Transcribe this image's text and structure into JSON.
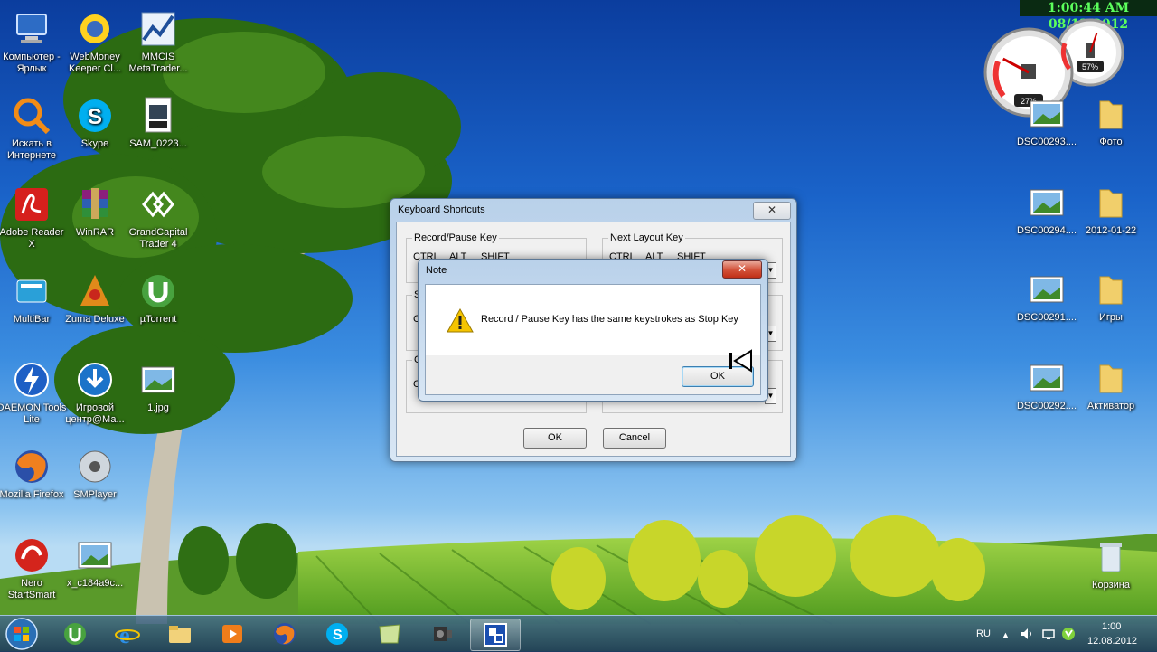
{
  "desktop": {
    "left_icons": [
      {
        "label": "Компьютер - Ярлык",
        "icon": "computer-icon"
      },
      {
        "label": "WebMoney Keeper Cl...",
        "icon": "webmoney-icon"
      },
      {
        "label": "MMCIS MetaTrader...",
        "icon": "metatrader-icon"
      },
      {
        "label": "Искать в Интернете",
        "icon": "search-globe-icon"
      },
      {
        "label": "Skype",
        "icon": "skype-icon"
      },
      {
        "label": "SAM_0223...",
        "icon": "video-file-icon"
      },
      {
        "label": "Adobe Reader X",
        "icon": "adobe-reader-icon"
      },
      {
        "label": "WinRAR",
        "icon": "winrar-icon"
      },
      {
        "label": "GrandCapital Trader 4",
        "icon": "grandcapital-icon"
      },
      {
        "label": "MultiBar",
        "icon": "multibar-icon"
      },
      {
        "label": "Zuma Deluxe",
        "icon": "zuma-icon"
      },
      {
        "label": "µTorrent",
        "icon": "utorrent-icon"
      },
      {
        "label": "DAEMON Tools Lite",
        "icon": "daemon-tools-icon"
      },
      {
        "label": "Игровой центр@Ма...",
        "icon": "game-center-icon"
      },
      {
        "label": "1.jpg",
        "icon": "image-file-icon"
      },
      {
        "label": "Mozilla Firefox",
        "icon": "firefox-icon"
      },
      {
        "label": "SMPlayer",
        "icon": "smplayer-icon"
      },
      {
        "label": "Nero StartSmart",
        "icon": "nero-icon"
      },
      {
        "label": "x_c184a9c...",
        "icon": "image-file-icon"
      }
    ],
    "right_icons": [
      {
        "label": "DSC00293....",
        "icon": "image-file-icon"
      },
      {
        "label": "Фото",
        "icon": "folder-icon"
      },
      {
        "label": "DSC00294....",
        "icon": "image-file-icon"
      },
      {
        "label": "2012-01-22",
        "icon": "folder-icon"
      },
      {
        "label": "DSC00291....",
        "icon": "image-file-icon"
      },
      {
        "label": "Игры",
        "icon": "folder-icon"
      },
      {
        "label": "DSC00292....",
        "icon": "image-file-icon"
      },
      {
        "label": "Активатор",
        "icon": "folder-icon"
      },
      {
        "label": "Корзина",
        "icon": "recycle-bin-icon"
      }
    ]
  },
  "gadgets": {
    "clock_text": "1:00:44 AM 08/12/2012",
    "cpu_percent": "27%",
    "memory_percent": "57%",
    "cpu_value": 27,
    "memory_value": 57
  },
  "shortcuts_window": {
    "title": "Keyboard Shortcuts",
    "record_pause_label": "Record/Pause Key",
    "next_layout_label": "Next Layout Key",
    "ctrl": "CTRL",
    "alt": "ALT",
    "shift": "SHIFT",
    "partial_label_s": "S",
    "partial_label_c1": "C",
    "partial_label_c2": "C",
    "partial_label_c3": "C",
    "ok_label": "OK",
    "cancel_label": "Cancel"
  },
  "note_dialog": {
    "title": "Note",
    "message": "Record / Pause Key has the same keystrokes as Stop Key",
    "ok_label": "OK",
    "close_glyph": "✕"
  },
  "taskbar": {
    "language": "RU",
    "time": "1:00",
    "date": "12.08.2012",
    "tray_up_glyph": "▲",
    "items": [
      "start-orb",
      "utorrent",
      "internet-explorer",
      "explorer",
      "media-player",
      "firefox",
      "skype",
      "notes",
      "camera-app",
      "screen-recorder"
    ]
  }
}
